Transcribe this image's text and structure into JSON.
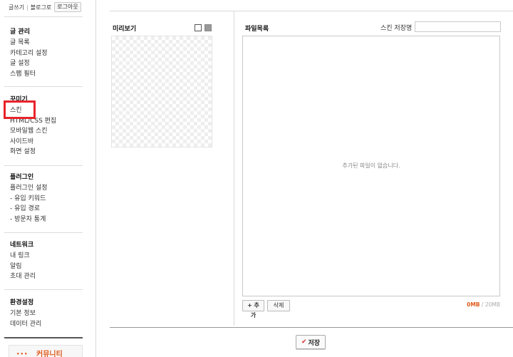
{
  "sidebar": {
    "top_links": {
      "write": "글쓰기",
      "manage": "블로그로",
      "logout": "로그아웃"
    },
    "sections": [
      {
        "title": "글 관리",
        "items": [
          "글 목록",
          "카테고리 설정",
          "글 설정",
          "스팸 필터"
        ]
      },
      {
        "title": "꾸미기",
        "items": [
          "스킨",
          "HTML/CSS 편집",
          "모바일웹 스킨",
          "사이드바",
          "화면 설정"
        ]
      },
      {
        "title": "플러그인",
        "items": [
          "플러그인 설정",
          "- 유입 키워드",
          "- 유입 경로",
          "- 방문자 통계"
        ]
      },
      {
        "title": "네트워크",
        "items": [
          "내 링크",
          "알림",
          "초대 관리"
        ]
      },
      {
        "title": "환경설정",
        "items": [
          "기본 정보",
          "데이터 관리"
        ]
      }
    ],
    "community": {
      "label": "커뮤니티",
      "dots": "•••"
    }
  },
  "main": {
    "preview_label": "미리보기",
    "files_label": "파일목록",
    "skin_name_label": "스킨 저장명",
    "skin_name_value": "",
    "empty_message": "추가된 파일이 없습니다.",
    "add_button": "+ 추가",
    "delete_button": "삭제",
    "usage_used": "0MB",
    "usage_sep": " / ",
    "usage_total": "20MB",
    "save_button": "저장",
    "save_icon": "✔"
  },
  "colors": {
    "accent": "#e05a1a",
    "highlight": "#e8232a"
  }
}
